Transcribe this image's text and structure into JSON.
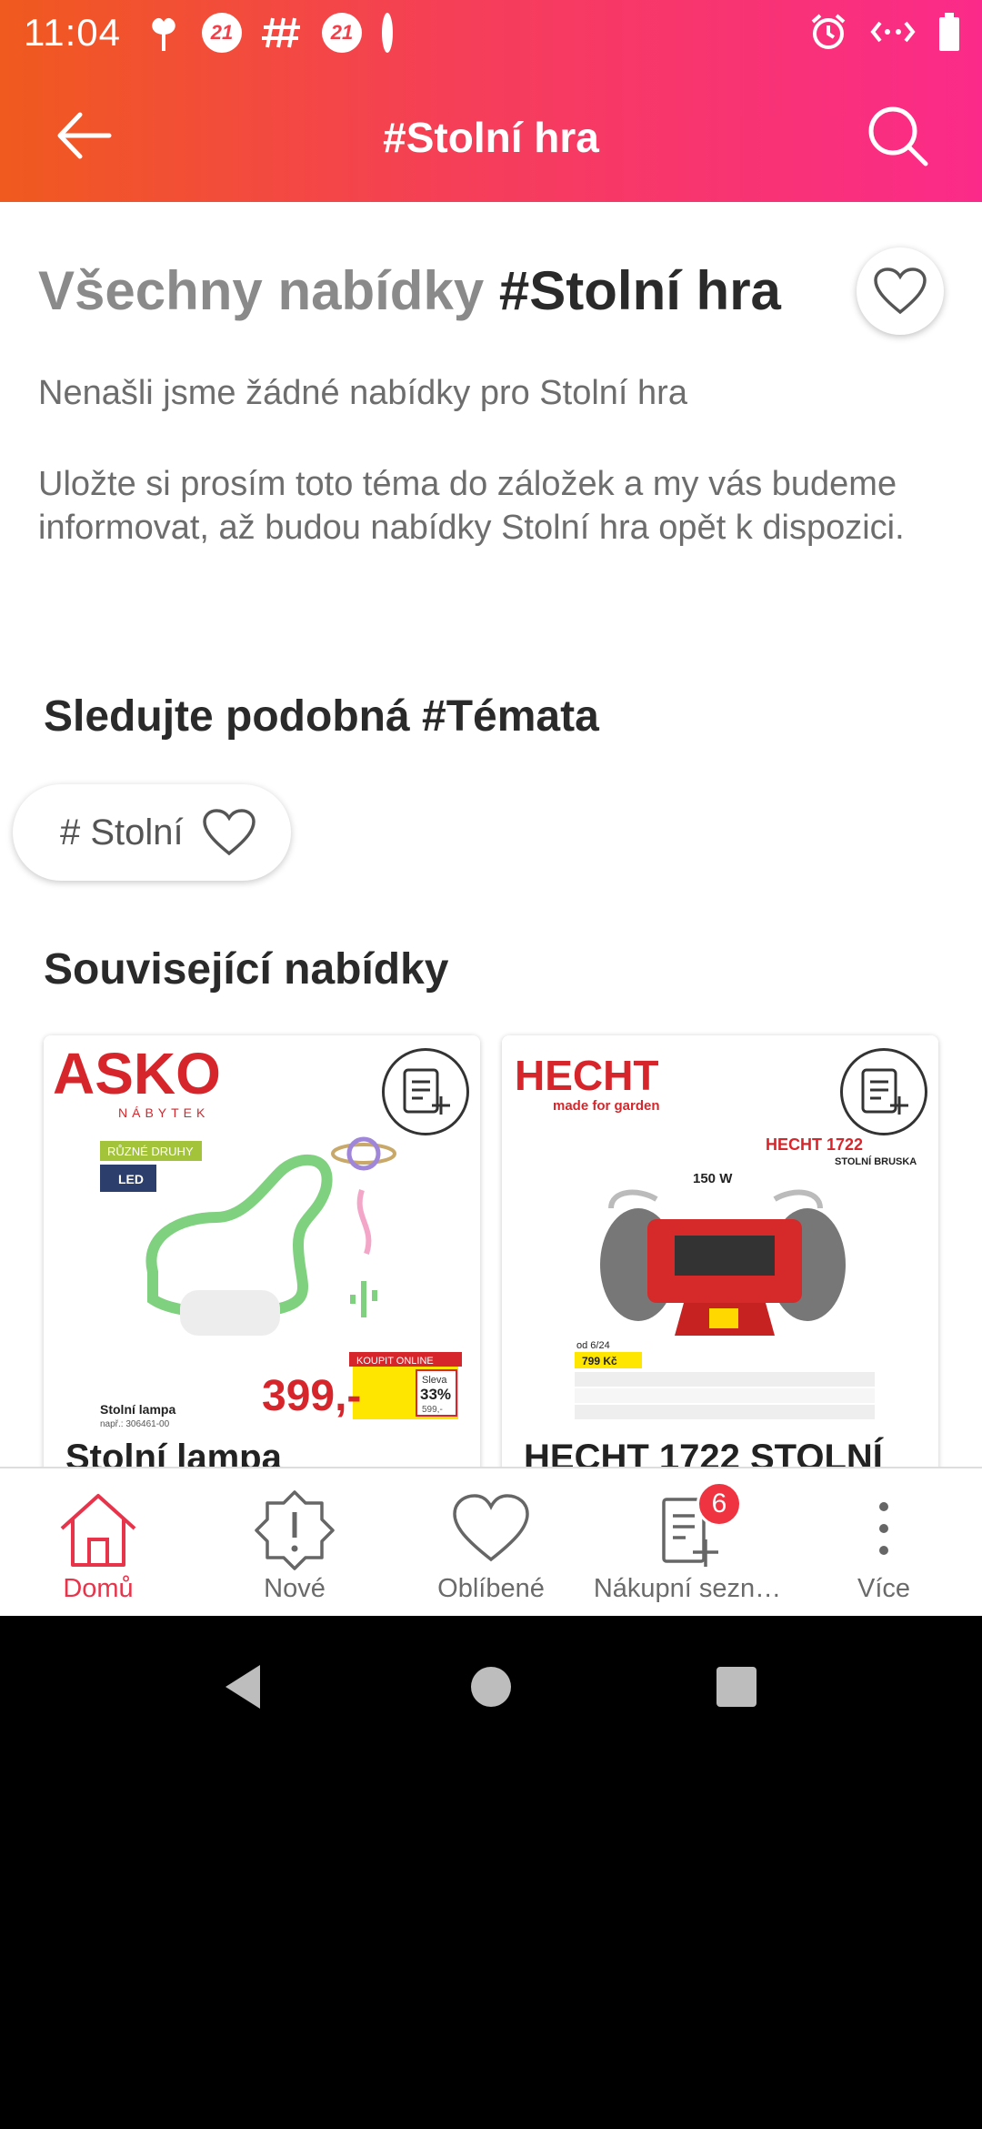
{
  "status_bar": {
    "time": "11:04",
    "badge_1": "21",
    "badge_2": "21"
  },
  "appbar": {
    "title": "#Stolní hra"
  },
  "page": {
    "heading_muted": "Všechny nabídky",
    "heading_strong": "#Stolní hra",
    "no_offers_text": "Nenašli jsme žádné nabídky pro Stolní hra",
    "bookmark_text": "Uložte si prosím toto téma do záložek a my vás budeme informovat, až budou nabídky Stolní hra opět k dispozici."
  },
  "similar_topics": {
    "title": "Sledujte podobná #Témata",
    "chips": [
      {
        "label": "# Stolní"
      }
    ]
  },
  "related_offers": {
    "title": "Související nabídky",
    "cards": [
      {
        "brand": "ASKO",
        "brand_sub": "NÁBYTEK",
        "tag": "RŮZNÉ DRUHY",
        "tag2": "LED",
        "product_caption": "Stolní lampa",
        "product_subcaption": "např.: 306461-00",
        "price": "399,-",
        "sale_tag": "KOUPIT ONLINE",
        "discount_label": "Sleva",
        "discount": "33%",
        "old_price": "599,-",
        "name": "Stolní lampa"
      },
      {
        "brand": "HECHT",
        "brand_sub": "made for garden",
        "model": "HECHT 1722",
        "model_sub": "STOLNÍ BRUSKA",
        "power": "150 W",
        "price_note": "od 6/24",
        "price": "799 Kč",
        "name": "HECHT 1722 STOLNÍ"
      }
    ]
  },
  "bottom_nav": {
    "items": [
      {
        "label": "Domů",
        "icon": "home-icon"
      },
      {
        "label": "Nové",
        "icon": "alert-badge-icon"
      },
      {
        "label": "Oblíbené",
        "icon": "heart-icon"
      },
      {
        "label": "Nákupní sezn…",
        "icon": "shopping-list-icon"
      },
      {
        "label": "Více",
        "icon": "more-vertical-icon"
      }
    ],
    "cart_count": "6"
  },
  "colors": {
    "accent": "#e8344b",
    "gradient_start": "#f05a1e",
    "gradient_end": "#fb2a8a"
  }
}
